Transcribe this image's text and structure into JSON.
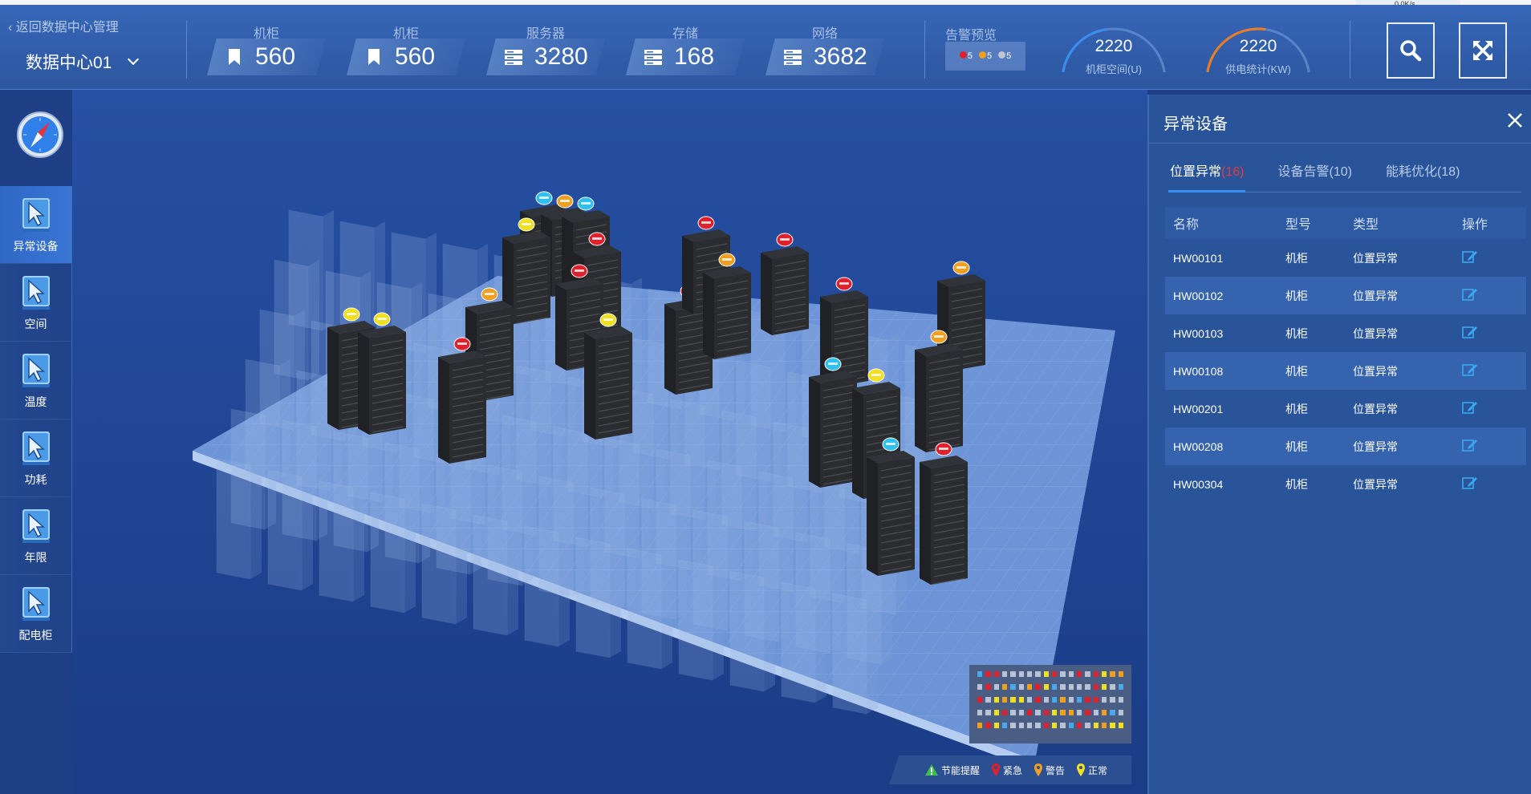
{
  "header": {
    "back_link": "返回数据中心管理",
    "datacenter": "数据中心01",
    "stats": [
      {
        "label": "机柜",
        "value": "560",
        "icon": "bookmark-icon"
      },
      {
        "label": "机柜",
        "value": "560",
        "icon": "bookmark-icon"
      },
      {
        "label": "服务器",
        "value": "3280",
        "icon": "server-icon"
      },
      {
        "label": "存储",
        "value": "168",
        "icon": "server-icon"
      },
      {
        "label": "网络",
        "value": "3682",
        "icon": "server-icon"
      }
    ],
    "alarm_preview": {
      "title": "告警预览",
      "counts": [
        {
          "value": "5",
          "color": "#e0202a"
        },
        {
          "value": "5",
          "color": "#f0a020"
        },
        {
          "value": "5",
          "color": "#bfc6d2"
        }
      ]
    },
    "gauges": [
      {
        "value": "2220",
        "label": "机柜空间(U)",
        "color": "#3a8ef0",
        "fraction": 0.45
      },
      {
        "value": "2220",
        "label": "供电统计(KW)",
        "color": "#f07c20",
        "fraction": 0.55
      }
    ],
    "network_status": "0.0K/s",
    "buttons": [
      {
        "name": "search-button",
        "icon": "search-icon"
      },
      {
        "name": "fullscreen-button",
        "icon": "expand-icon"
      }
    ]
  },
  "nav": {
    "items": [
      {
        "label": "异常设备",
        "active": true
      },
      {
        "label": "空间",
        "active": false
      },
      {
        "label": "温度",
        "active": false
      },
      {
        "label": "功耗",
        "active": false
      },
      {
        "label": "年限",
        "active": false
      },
      {
        "label": "配电柜",
        "active": false
      }
    ]
  },
  "legend": {
    "items": [
      {
        "label": "节能提醒",
        "icon": "warning-triangle-icon",
        "color": "#3ac24a"
      },
      {
        "label": "紧急",
        "icon": "pin-icon",
        "color": "#e0202a"
      },
      {
        "label": "警告",
        "icon": "pin-icon",
        "color": "#f0a020"
      },
      {
        "label": "正常",
        "icon": "pin-icon",
        "color": "#f0e020"
      }
    ]
  },
  "panel": {
    "title": "异常设备",
    "tabs": [
      {
        "label": "位置异常",
        "count": "(16)",
        "active": true
      },
      {
        "label": "设备告警",
        "count": "(10)",
        "active": false
      },
      {
        "label": "能耗优化",
        "count": "(18)",
        "active": false
      }
    ],
    "columns": [
      "名称",
      "型号",
      "类型",
      "操作"
    ],
    "rows": [
      {
        "name": "HW00101",
        "model": "机柜",
        "type": "位置异常"
      },
      {
        "name": "HW00102",
        "model": "机柜",
        "type": "位置异常"
      },
      {
        "name": "HW00103",
        "model": "机柜",
        "type": "位置异常"
      },
      {
        "name": "HW00108",
        "model": "机柜",
        "type": "位置异常"
      },
      {
        "name": "HW00201",
        "model": "机柜",
        "type": "位置异常"
      },
      {
        "name": "HW00208",
        "model": "机柜",
        "type": "位置异常"
      },
      {
        "name": "HW00304",
        "model": "机柜",
        "type": "位置异常"
      }
    ]
  },
  "colors": {
    "accent": "#3a8ef0",
    "alarm_red": "#e0202a",
    "alarm_orange": "#f0a020",
    "alarm_yellow": "#f0e020",
    "alarm_blue": "#2ec0f0"
  }
}
